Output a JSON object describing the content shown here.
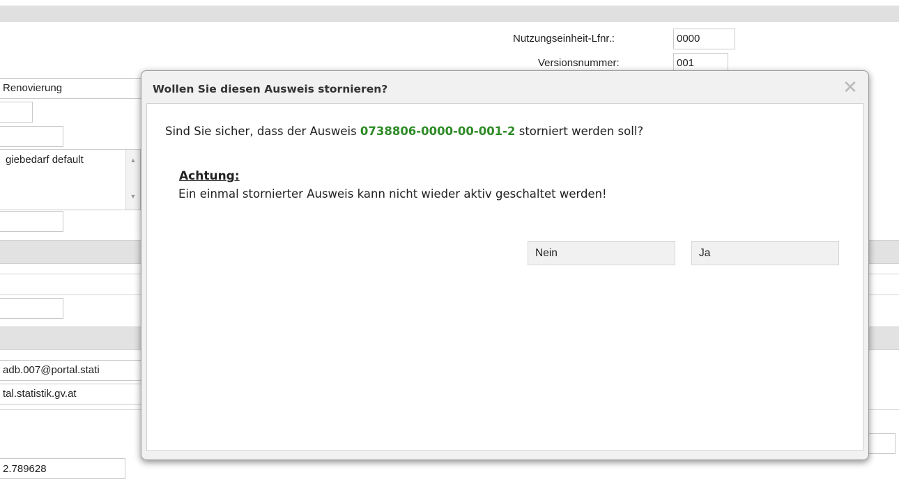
{
  "background": {
    "labels": {
      "nutzungseinheit": "Nutzungseinheit-Lfnr.:",
      "versionsnummer": "Versionsnummer:",
      "renovierung": "Renovierung",
      "energiebedarf": "giebedarf default",
      "email_1": "adb.007@portal.stati",
      "email_2": "tal.statistik.gv.at",
      "number": "2.789628"
    },
    "fields": {
      "nutzungseinheit_value": "0000",
      "versionsnummer_value": "001"
    }
  },
  "dialog": {
    "title": "Wollen Sie diesen Ausweis stornieren?",
    "question_prefix": "Sind Sie sicher, dass der Ausweis ",
    "ausweis_number": "0738806-0000-00-001-2",
    "question_suffix": " storniert werden soll?",
    "warning_heading": "Achtung:",
    "warning_text": "Ein einmal stornierter Ausweis kann nicht wieder aktiv geschaltet werden!",
    "buttons": {
      "no": "Nein",
      "yes": "Ja"
    },
    "close_icon": "close-icon"
  },
  "colors": {
    "accent_green": "#2e8b26",
    "section_gray": "#e2e2e2"
  }
}
